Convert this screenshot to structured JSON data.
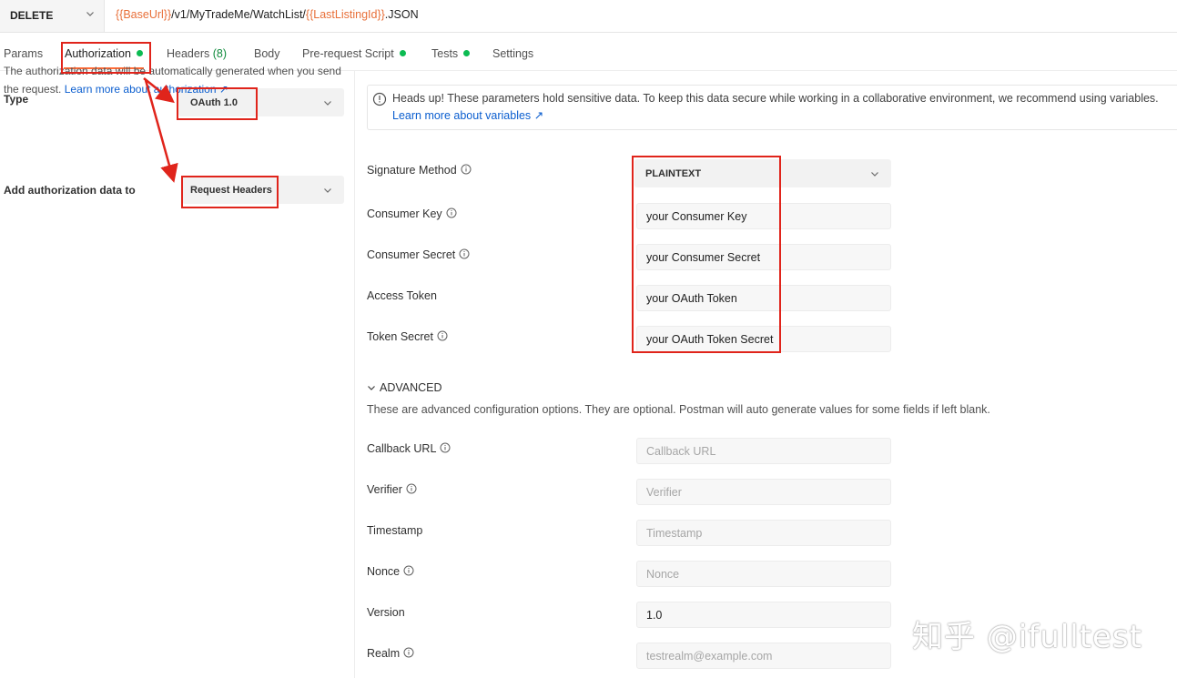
{
  "request": {
    "method": "DELETE",
    "url_parts": [
      {
        "text": "{{BaseUrl}}",
        "var": true
      },
      {
        "text": "/v1/MyTradeMe/WatchList/",
        "var": false
      },
      {
        "text": "{{LastListingId}}",
        "var": true
      },
      {
        "text": ".JSON",
        "var": false
      }
    ]
  },
  "tabs": {
    "params": "Params",
    "authorization": "Authorization",
    "headers": "Headers",
    "headers_count": "(8)",
    "body": "Body",
    "prerequest": "Pre-request Script",
    "tests": "Tests",
    "settings": "Settings"
  },
  "auth": {
    "type_label": "Type",
    "type_value": "OAuth 1.0",
    "description": "The authorization data will be automatically generated when you send the request.",
    "learn_more": "Learn more about authorization ↗",
    "add_to_label": "Add authorization data to",
    "add_to_value": "Request Headers"
  },
  "notice": {
    "text": "Heads up! These parameters hold sensitive data. To keep this data secure while working in a collaborative environment, we recommend using variables.",
    "link": "Learn more about variables ↗"
  },
  "fields": {
    "signature_method": {
      "label": "Signature Method",
      "value": "PLAINTEXT"
    },
    "consumer_key": {
      "label": "Consumer Key",
      "value": "your Consumer Key"
    },
    "consumer_secret": {
      "label": "Consumer Secret",
      "value": "your Consumer Secret"
    },
    "access_token": {
      "label": "Access Token",
      "value": "your OAuth Token"
    },
    "token_secret": {
      "label": "Token Secret",
      "value": "your OAuth Token Secret"
    }
  },
  "advanced": {
    "title": "ADVANCED",
    "description": "These are advanced configuration options. They are optional. Postman will auto generate values for some fields if left blank.",
    "callback_url": {
      "label": "Callback URL",
      "placeholder": "Callback URL",
      "value": ""
    },
    "verifier": {
      "label": "Verifier",
      "placeholder": "Verifier",
      "value": ""
    },
    "timestamp": {
      "label": "Timestamp",
      "placeholder": "Timestamp",
      "value": ""
    },
    "nonce": {
      "label": "Nonce",
      "placeholder": "Nonce",
      "value": ""
    },
    "version": {
      "label": "Version",
      "placeholder": "",
      "value": "1.0"
    },
    "realm": {
      "label": "Realm",
      "placeholder": "testrealm@example.com",
      "value": ""
    }
  },
  "watermark": "知乎 @ifulltest",
  "colors": {
    "accent": "#ff6c37",
    "variable": "#e8703a",
    "link": "#0b5ecf",
    "status_dot": "#0cbb52",
    "annotation": "#e0241b"
  },
  "icons": {
    "dropdown": "chevron-down-icon",
    "info": "info-icon",
    "notice": "info-circle-icon"
  }
}
